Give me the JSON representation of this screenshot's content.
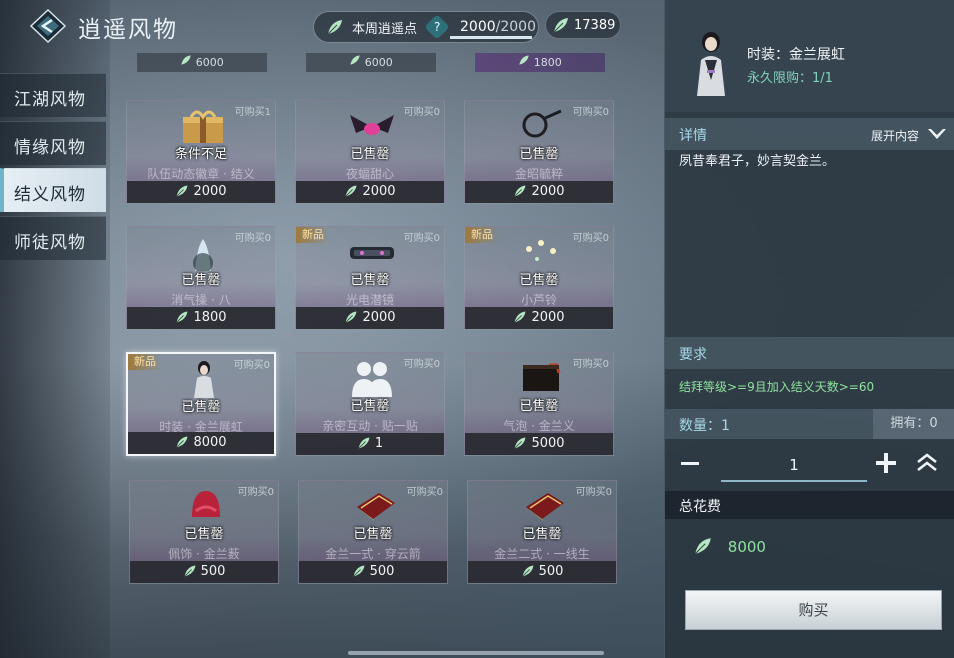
{
  "header": {
    "title": "逍遥风物",
    "points_label": "本周逍遥点",
    "points_help": "?",
    "points_current": "2000",
    "points_max": "/2000",
    "points_fill": 1.0,
    "coins": "17389"
  },
  "tabs": [
    {
      "label": "江湖风物",
      "active": false
    },
    {
      "label": "情缘风物",
      "active": false
    },
    {
      "label": "结义风物",
      "active": true
    },
    {
      "label": "师徒风物",
      "active": false
    }
  ],
  "top_strips": [
    "6000",
    "6000",
    "1800"
  ],
  "items": [
    {
      "name": "队伍动态徽章 · 结义",
      "status": "条件不足",
      "badge": "可购买1",
      "price": "2000",
      "new": "",
      "icon": "gift-box-icon"
    },
    {
      "name": "夜蝠甜心",
      "status": "已售罄",
      "badge": "可购买0",
      "price": "2000",
      "new": "",
      "icon": "bat-wings-icon"
    },
    {
      "name": "金昭毓粹",
      "status": "已售罄",
      "badge": "可购买0",
      "price": "2000",
      "new": "",
      "icon": "magnifier-icon"
    },
    {
      "name": "消气操 · 八",
      "status": "已售罄",
      "badge": "可购买0",
      "price": "1800",
      "new": "",
      "icon": "spirit-figure-icon"
    },
    {
      "name": "光电潜镜",
      "status": "已售罄",
      "badge": "可购买0",
      "price": "2000",
      "new": "新品",
      "icon": "visor-glasses-icon"
    },
    {
      "name": "小芦铃",
      "status": "已售罄",
      "badge": "可购买0",
      "price": "2000",
      "new": "新品",
      "icon": "sparkle-bells-icon"
    },
    {
      "name": "时装 · 金兰展虹",
      "status": "已售罄",
      "badge": "可购买0",
      "price": "8000",
      "new": "新品",
      "icon": "costume-figure-icon"
    },
    {
      "name": "亲密互动 · 贴一贴",
      "status": "已售罄",
      "badge": "可购买0",
      "price": "1",
      "new": "",
      "icon": "two-persons-icon"
    },
    {
      "name": "气泡 · 金兰义",
      "status": "已售罄",
      "badge": "可购买0",
      "price": "5000",
      "new": "",
      "icon": "speech-bubble-icon"
    },
    {
      "name": "佩饰 · 金兰薮",
      "status": "已售罄",
      "badge": "可购买0",
      "price": "500",
      "new": "",
      "icon": "red-hood-icon"
    },
    {
      "name": "金兰一式 · 穿云箭",
      "status": "已售罄",
      "badge": "可购买0",
      "price": "500",
      "new": "",
      "icon": "book-scroll-icon"
    },
    {
      "name": "金兰二式 · 一线生",
      "status": "已售罄",
      "badge": "可购买0",
      "price": "500",
      "new": "",
      "icon": "book-scroll-icon"
    }
  ],
  "detail": {
    "name": "时装：金兰展虹",
    "limit": "永久限购：1/1",
    "section_details": "详情",
    "expand": "展开内容",
    "description": "夙昔奉君子，妙言契金兰。",
    "section_requirements": "要求",
    "requirement": "结拜等级>=9且加入结义天数>=60",
    "quantity_label": "数量：1",
    "owned": "拥有：0",
    "quantity_value": "1",
    "total_label": "总花费",
    "total_value": "8000",
    "buy_label": "购买"
  },
  "colors": {
    "accent_green": "#8fe0a0",
    "accent_teal": "#a7d8e7",
    "limit_green": "#7fd3b8"
  }
}
